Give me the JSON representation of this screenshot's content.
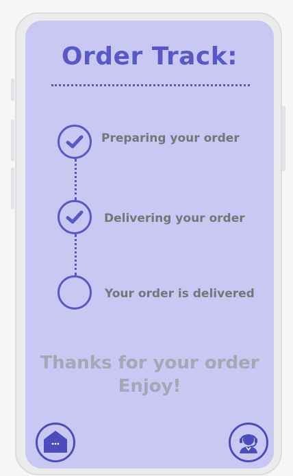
{
  "header": {
    "title": "Order Track:"
  },
  "steps": [
    {
      "label": "Preparing your order",
      "completed": true,
      "icon": "check-icon"
    },
    {
      "label": "Delivering your order",
      "completed": true,
      "icon": "check-icon"
    },
    {
      "label": "Your order is delivered",
      "completed": false,
      "icon": "empty-circle"
    }
  ],
  "message": {
    "line1": "Thanks for your order",
    "line2": "Enjoy!"
  },
  "nav": {
    "home_icon": "home-icon",
    "support_icon": "support-agent-icon"
  },
  "colors": {
    "accent": "#5858c8",
    "screen_background": "#c8c8f2",
    "step_text": "#75757a",
    "message_text": "#a6a6b6"
  }
}
